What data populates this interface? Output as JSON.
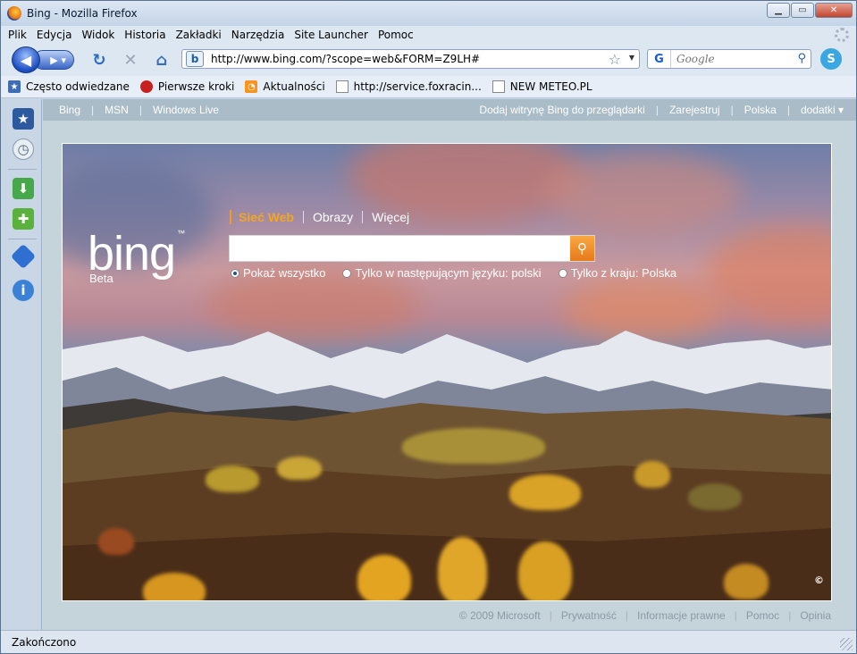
{
  "window": {
    "title": "Bing - Mozilla Firefox"
  },
  "menu": [
    "Plik",
    "Edycja",
    "Widok",
    "Historia",
    "Zakładki",
    "Narzędzia",
    "Site Launcher",
    "Pomoc"
  ],
  "nav": {
    "url": "http://www.bing.com/?scope=web&FORM=Z9LH#",
    "search_engine_letter": "G",
    "search_placeholder": "Google"
  },
  "bookmarks": [
    {
      "label": "Często odwiedzane",
      "icon": "star-icon"
    },
    {
      "label": "Pierwsze kroki",
      "icon": "firefox-icon"
    },
    {
      "label": "Aktualności",
      "icon": "rss-icon"
    },
    {
      "label": "http://service.foxracin...",
      "icon": "page-icon"
    },
    {
      "label": "NEW METEO.PL",
      "icon": "page-icon"
    }
  ],
  "bing": {
    "nav_left": [
      "Bing",
      "MSN",
      "Windows Live"
    ],
    "nav_right": [
      "Dodaj witrynę Bing do przeglądarki",
      "Zarejestruj",
      "Polska",
      "dodatki ▾"
    ],
    "logo": "bing",
    "logo_tm": "™",
    "beta": "Beta",
    "scopes": [
      "Sieć Web",
      "Obrazy",
      "Więcej"
    ],
    "query": "",
    "radios": [
      "Pokaż wszystko",
      "Tylko w następującym języku: polski",
      "Tylko z kraju: Polska"
    ],
    "copyright_icon": "©",
    "footer": [
      "© 2009 Microsoft",
      "Prywatność",
      "Informacje prawne",
      "Pomoc",
      "Opinia"
    ]
  },
  "status": {
    "text": "Zakończono"
  },
  "colors": {
    "accent": "#f5a524",
    "nav_bg": "#a9bcc7"
  }
}
